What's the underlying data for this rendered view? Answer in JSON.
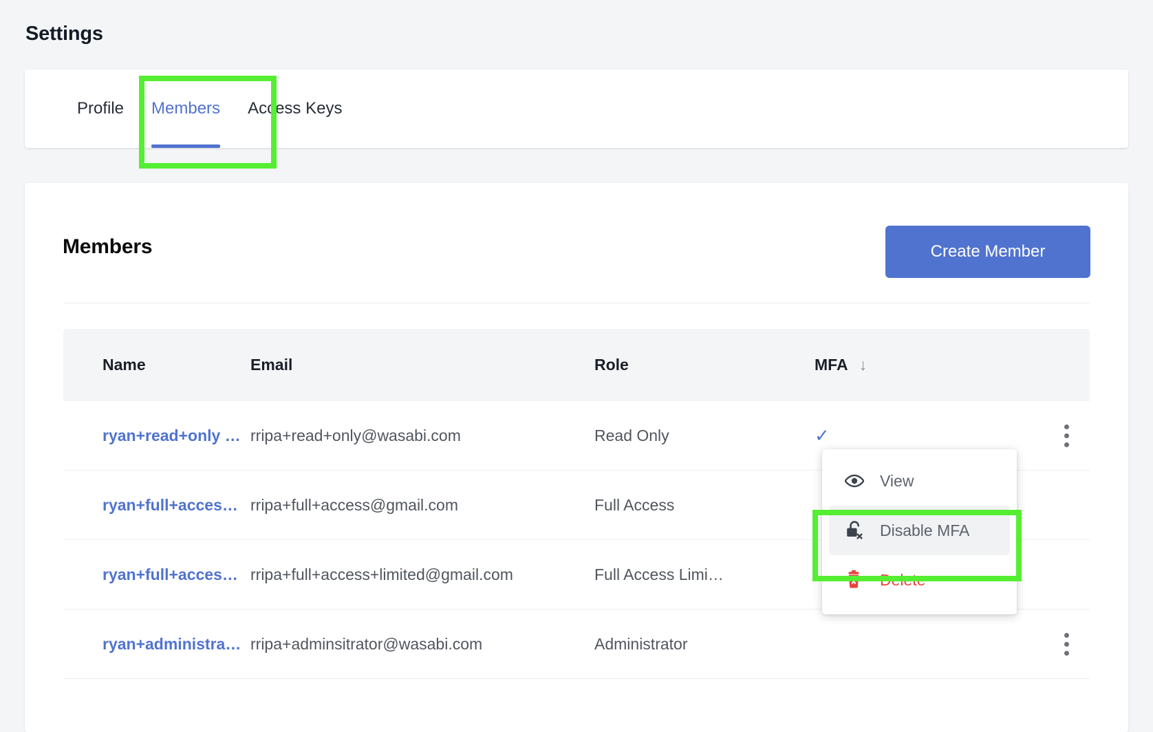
{
  "page": {
    "title": "Settings"
  },
  "tabs": [
    {
      "label": "Profile",
      "active": false
    },
    {
      "label": "Members",
      "active": true
    },
    {
      "label": "Access Keys",
      "active": false
    }
  ],
  "members_section": {
    "heading": "Members",
    "create_button": "Create Member"
  },
  "table": {
    "columns": [
      "Name",
      "Email",
      "Role",
      "MFA"
    ],
    "sort": {
      "column": "MFA",
      "direction": "descending",
      "glyph": "↓"
    },
    "rows": [
      {
        "name": "ryan+read+only …",
        "email": "rripa+read+only@wasabi.com",
        "role": "Read Only",
        "mfa": "✓",
        "mfa_enabled": true
      },
      {
        "name": "ryan+full+acces…",
        "email": "rripa+full+access@gmail.com",
        "role": "Full Access",
        "mfa": "",
        "mfa_enabled": false
      },
      {
        "name": "ryan+full+acces…",
        "email": "rripa+full+access+limited@gmail.com",
        "role": "Full Access Limi…",
        "mfa": "",
        "mfa_enabled": false
      },
      {
        "name": "ryan+administra…",
        "email": "rripa+adminsitrator@wasabi.com",
        "role": "Administrator",
        "mfa": "",
        "mfa_enabled": false
      }
    ]
  },
  "context_menu": {
    "items": [
      {
        "label": "View",
        "icon": "eye-icon",
        "state": "normal"
      },
      {
        "label": "Disable MFA",
        "icon": "unlock-x-icon",
        "state": "hovered"
      },
      {
        "label": "Delete",
        "icon": "trash-x-icon",
        "state": "danger"
      }
    ]
  },
  "colors": {
    "accent": "#5073cf",
    "danger": "#e8453c",
    "page_bg": "#f4f5f7",
    "card_bg": "#ffffff",
    "highlight": "#55ee33",
    "text_primary": "#131b26",
    "text_secondary": "#50555e"
  }
}
